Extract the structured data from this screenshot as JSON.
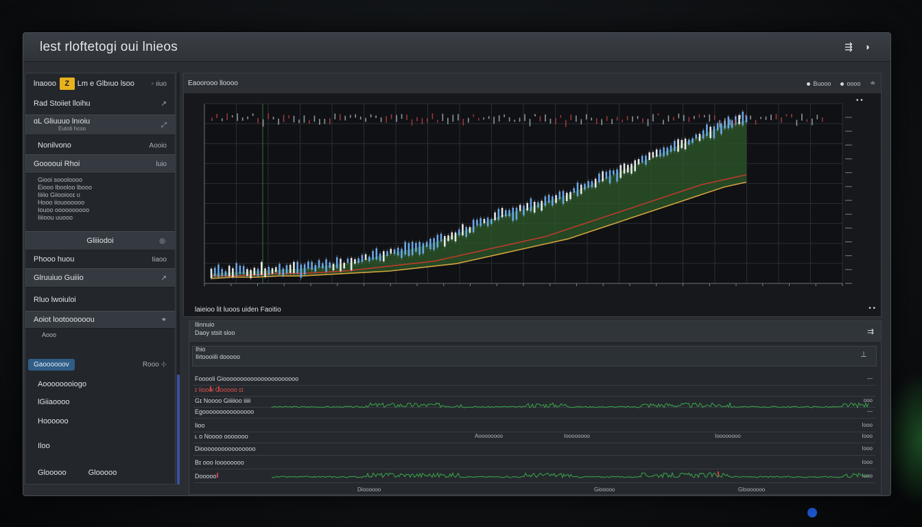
{
  "window": {
    "title": "lest rloftetogi oui lnieos"
  },
  "titlebar": {
    "icon_a": "⇶",
    "icon_b": "◗"
  },
  "sidebar": {
    "header_label": "lnaooo",
    "header_logo": "Z",
    "header_text": "Lm e Glbıuo lsoo",
    "header_right": "◦ ıiuo",
    "items": [
      {
        "label": "Rad Stoiiet lloihu",
        "right": "↗"
      },
      {
        "label": "ɑL  Gliuuuo lnıoiu",
        "sub": "Eutoti hcoo",
        "right": "⤢"
      },
      {
        "label": "Nonilvono",
        "right": "Aooio"
      },
      {
        "label": "Gooooui  Rhoi",
        "right": "luio"
      }
    ],
    "sub_lines": [
      "Giooi soooloooo",
      "Eiooo  lbooloo lbooo",
      "Iiiiio Giiooiooɪ ʊ",
      "Hooo iiouoooooo",
      "Iouoo oooooooooo",
      "Iiiioou uuooo"
    ],
    "section2": [
      {
        "label": "Gliiiodoi",
        "right": "◎"
      },
      {
        "label": "Phooo huou",
        "right": "Iiaoo"
      },
      {
        "label": "Glruuiuo  Guiiio",
        "right": "↗"
      },
      {
        "label": "Rluo  lwoiuloi",
        "right": ""
      },
      {
        "label": "Aoiot  lootoooooou",
        "sub": "Aooo",
        "right": "⚭"
      }
    ],
    "selected": {
      "label": "Gaoooooov",
      "right": "Rooo ⊹"
    },
    "tail": [
      "Aoooooooiogo",
      "lGiiaoooo",
      "Hoooooo",
      "Iloo"
    ],
    "bottom": {
      "left": "Glooooo",
      "right": "Glooooo"
    }
  },
  "chart_panel": {
    "title": "Eaoorooo lloooo",
    "right_a": "Buooo",
    "right_b": "oooo",
    "right_icon": "≐",
    "footer": "laieioo lit luoos uiden Faoitio",
    "footer_dots": "• •",
    "top_dots": "•  •"
  },
  "chart_data": {
    "type": "line",
    "colors": {
      "up": "#6aa8e8",
      "down": "#e8e8e8",
      "red_line": "#c0392b",
      "gold_line": "#d4a43c",
      "fill": "#2e5a2a"
    },
    "series": [
      {
        "values": [
          8,
          9,
          10,
          11,
          12,
          14,
          16,
          20,
          24,
          28,
          33,
          40,
          48,
          55,
          60,
          66,
          72,
          80,
          88,
          96,
          104,
          112,
          120,
          128,
          132
        ]
      },
      {
        "values": [
          6,
          6,
          7,
          8,
          8,
          9,
          10,
          12,
          14,
          16,
          18,
          22,
          26,
          30,
          34,
          38,
          44,
          50,
          56,
          62,
          68,
          74,
          80,
          84,
          88
        ]
      },
      {
        "values": [
          4,
          5,
          5,
          6,
          6,
          7,
          8,
          9,
          10,
          12,
          14,
          16,
          20,
          24,
          28,
          32,
          36,
          42,
          48,
          54,
          60,
          66,
          72,
          78,
          82
        ]
      }
    ],
    "ylim": [
      0,
      140
    ]
  },
  "lower_panel": {
    "head_lines": [
      "Ilinnuio",
      "Daoy stsit sloo",
      "Ihio"
    ],
    "head_right": "⇉",
    "input_value": "Ilıtoooiili dooooo",
    "rows": [
      {
        "text": "Fooooli Gioooooooooooooooooooooo",
        "right": "—",
        "red": false
      },
      {
        "text": "ɪ Iioooi Gooooo ɪɪ",
        "right": "",
        "red": true
      },
      {
        "text": "Gɪ Noooo Giiiiioo iiiii",
        "right": "ooo",
        "red": false
      },
      {
        "text": "Egooooooooooooooo",
        "right": "—",
        "red": false
      },
      {
        "text": "Iioo",
        "right": "Iooo",
        "red": false
      },
      {
        "text": "ʟ o Noooo ooooooo",
        "mid1": "Aoooooooo",
        "mid2": "Ioooooooo",
        "mid3": "Ioooooooo",
        "right": "Iooo",
        "red": false
      },
      {
        "text": "Dioooooooooooooooo",
        "right": "Iooo",
        "red": false
      },
      {
        "text": "Bɪ ooo Ioooooooo",
        "right": "Iooo",
        "red": false
      },
      {
        "text": "Dooooo",
        "right": "Iooo",
        "red": false
      }
    ],
    "bottom_a": "Dioooooo",
    "bottom_b": "Giooooo",
    "bottom_c": "Glooooooo"
  }
}
